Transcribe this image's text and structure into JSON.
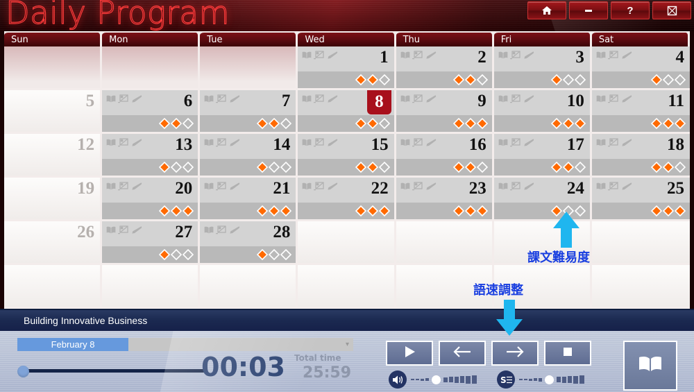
{
  "window": {
    "app_title": "Daily Program",
    "buttons": [
      {
        "name": "home-button",
        "icon": "home-icon",
        "label": ""
      },
      {
        "name": "minimize-button",
        "icon": "minimize-icon",
        "label": ""
      },
      {
        "name": "help-button",
        "icon": "question-icon",
        "label": "?"
      },
      {
        "name": "close-button",
        "icon": "close-icon",
        "label": ""
      }
    ]
  },
  "calendar": {
    "day_headers": [
      "Sun",
      "Mon",
      "Tue",
      "Wed",
      "Thu",
      "Fri",
      "Sat"
    ],
    "selected_day": 8,
    "icon_set": [
      "book-icon",
      "image-icon",
      "pencil-icon"
    ],
    "cells": [
      {
        "day": "",
        "state": "lead-empty",
        "difficulty": null
      },
      {
        "day": "",
        "state": "lead-empty",
        "difficulty": null
      },
      {
        "day": "",
        "state": "lead-empty",
        "difficulty": null
      },
      {
        "day": "1",
        "state": "content",
        "difficulty": 2
      },
      {
        "day": "2",
        "state": "content",
        "difficulty": 2
      },
      {
        "day": "3",
        "state": "content",
        "difficulty": 1
      },
      {
        "day": "4",
        "state": "content",
        "difficulty": 1
      },
      {
        "day": "5",
        "state": "empty",
        "difficulty": null
      },
      {
        "day": "6",
        "state": "content",
        "difficulty": 2
      },
      {
        "day": "7",
        "state": "content",
        "difficulty": 2
      },
      {
        "day": "8",
        "state": "selected",
        "difficulty": 2
      },
      {
        "day": "9",
        "state": "content",
        "difficulty": 3
      },
      {
        "day": "10",
        "state": "content",
        "difficulty": 3
      },
      {
        "day": "11",
        "state": "content",
        "difficulty": 3
      },
      {
        "day": "12",
        "state": "empty",
        "difficulty": null
      },
      {
        "day": "13",
        "state": "content",
        "difficulty": 1
      },
      {
        "day": "14",
        "state": "content",
        "difficulty": 1
      },
      {
        "day": "15",
        "state": "content",
        "difficulty": 2
      },
      {
        "day": "16",
        "state": "content",
        "difficulty": 2
      },
      {
        "day": "17",
        "state": "content",
        "difficulty": 2
      },
      {
        "day": "18",
        "state": "content",
        "difficulty": 2
      },
      {
        "day": "19",
        "state": "empty",
        "difficulty": null
      },
      {
        "day": "20",
        "state": "content",
        "difficulty": 3
      },
      {
        "day": "21",
        "state": "content",
        "difficulty": 3
      },
      {
        "day": "22",
        "state": "content",
        "difficulty": 3
      },
      {
        "day": "23",
        "state": "content",
        "difficulty": 3
      },
      {
        "day": "24",
        "state": "content",
        "difficulty": 1
      },
      {
        "day": "25",
        "state": "content",
        "difficulty": 3
      },
      {
        "day": "26",
        "state": "empty",
        "difficulty": null
      },
      {
        "day": "27",
        "state": "content",
        "difficulty": 1
      },
      {
        "day": "28",
        "state": "content",
        "difficulty": 1
      },
      {
        "day": "",
        "state": "blank",
        "difficulty": null
      },
      {
        "day": "",
        "state": "blank",
        "difficulty": null
      },
      {
        "day": "",
        "state": "blank",
        "difficulty": null
      },
      {
        "day": "",
        "state": "blank",
        "difficulty": null
      },
      {
        "day": "",
        "state": "blank",
        "difficulty": null
      },
      {
        "day": "",
        "state": "blank",
        "difficulty": null
      },
      {
        "day": "",
        "state": "blank",
        "difficulty": null
      },
      {
        "day": "",
        "state": "blank",
        "difficulty": null
      },
      {
        "day": "",
        "state": "blank",
        "difficulty": null
      },
      {
        "day": "",
        "state": "blank",
        "difficulty": null
      },
      {
        "day": "",
        "state": "blank",
        "difficulty": null
      }
    ]
  },
  "annotations": [
    {
      "name": "difficulty-annotation",
      "text": "課文難易度",
      "color": "#1a3fe0"
    },
    {
      "name": "speed-annotation",
      "text": "語速調整",
      "color": "#1a3fe0"
    }
  ],
  "player": {
    "lesson_title": "Building Innovative Business",
    "date_selector": {
      "selected": "February 8",
      "placeholder": "February 8"
    },
    "elapsed_time": "00:03",
    "total_time_label": "Total time",
    "total_time": "25:59",
    "controls": [
      {
        "name": "play-button",
        "icon": "play-icon"
      },
      {
        "name": "previous-button",
        "icon": "arrow-left-icon"
      },
      {
        "name": "next-button",
        "icon": "arrow-right-icon"
      },
      {
        "name": "stop-button",
        "icon": "stop-icon"
      }
    ],
    "volume_slider": {
      "name": "volume-slider",
      "icon": "speaker-icon",
      "position": 4,
      "steps": 10
    },
    "speed_slider": {
      "name": "speed-slider",
      "icon": "speed-s-icon",
      "position": 5,
      "steps": 10
    },
    "notebook_button": {
      "name": "notebook-button",
      "icon": "open-book-icon"
    }
  },
  "colors": {
    "brand_red": "#7e1216",
    "selected_day_bg": "#a8101c",
    "difficulty_filled": "#ff6a00",
    "annotation_blue": "#1a3fe0",
    "player_navy": "#1b2950"
  }
}
